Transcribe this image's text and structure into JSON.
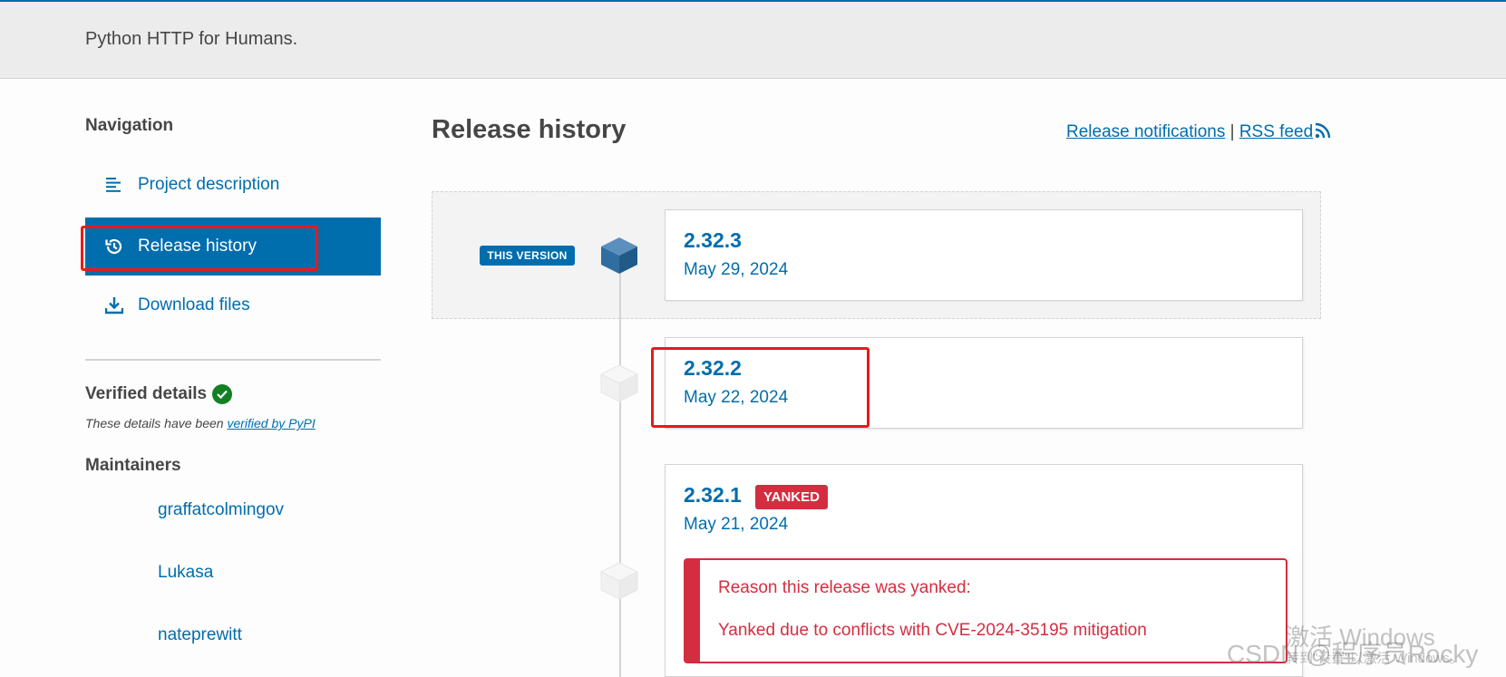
{
  "header": {
    "summary": "Python HTTP for Humans."
  },
  "sidebar": {
    "nav_heading": "Navigation",
    "items": [
      {
        "label": "Project description",
        "icon": "align-left-icon",
        "active": false
      },
      {
        "label": "Release history",
        "icon": "history-icon",
        "active": true
      },
      {
        "label": "Download files",
        "icon": "download-icon",
        "active": false
      }
    ],
    "verified": {
      "heading": "Verified details",
      "note_prefix": "These details have been ",
      "note_link": "verified by PyPI"
    },
    "maintainers": {
      "heading": "Maintainers",
      "names": [
        "graffatcolmingov",
        "Lukasa",
        "nateprewitt"
      ]
    }
  },
  "main": {
    "title": "Release history",
    "links": {
      "notifications": "Release notifications",
      "separator": "|",
      "rss": "RSS feed"
    },
    "this_version_badge": "THIS VERSION",
    "releases": [
      {
        "version": "2.32.3",
        "date": "May 29, 2024",
        "current": true
      },
      {
        "version": "2.32.2",
        "date": "May 22, 2024",
        "current": false
      },
      {
        "version": "2.32.1",
        "date": "May 21, 2024",
        "current": false,
        "badge": "YANKED",
        "yank_title": "Reason this release was yanked:",
        "yank_reason": "Yanked due to conflicts with CVE-2024-35195 mitigation"
      }
    ]
  },
  "watermark": {
    "line1": "激活 Windows",
    "line2": "CSDN @程序员Rocky",
    "line3": "转到\"设置\"以激活 Windows。"
  },
  "colors": {
    "primary": "#006dad",
    "danger": "#d52d40",
    "success": "#148024",
    "annotation": "#e81a1a"
  }
}
